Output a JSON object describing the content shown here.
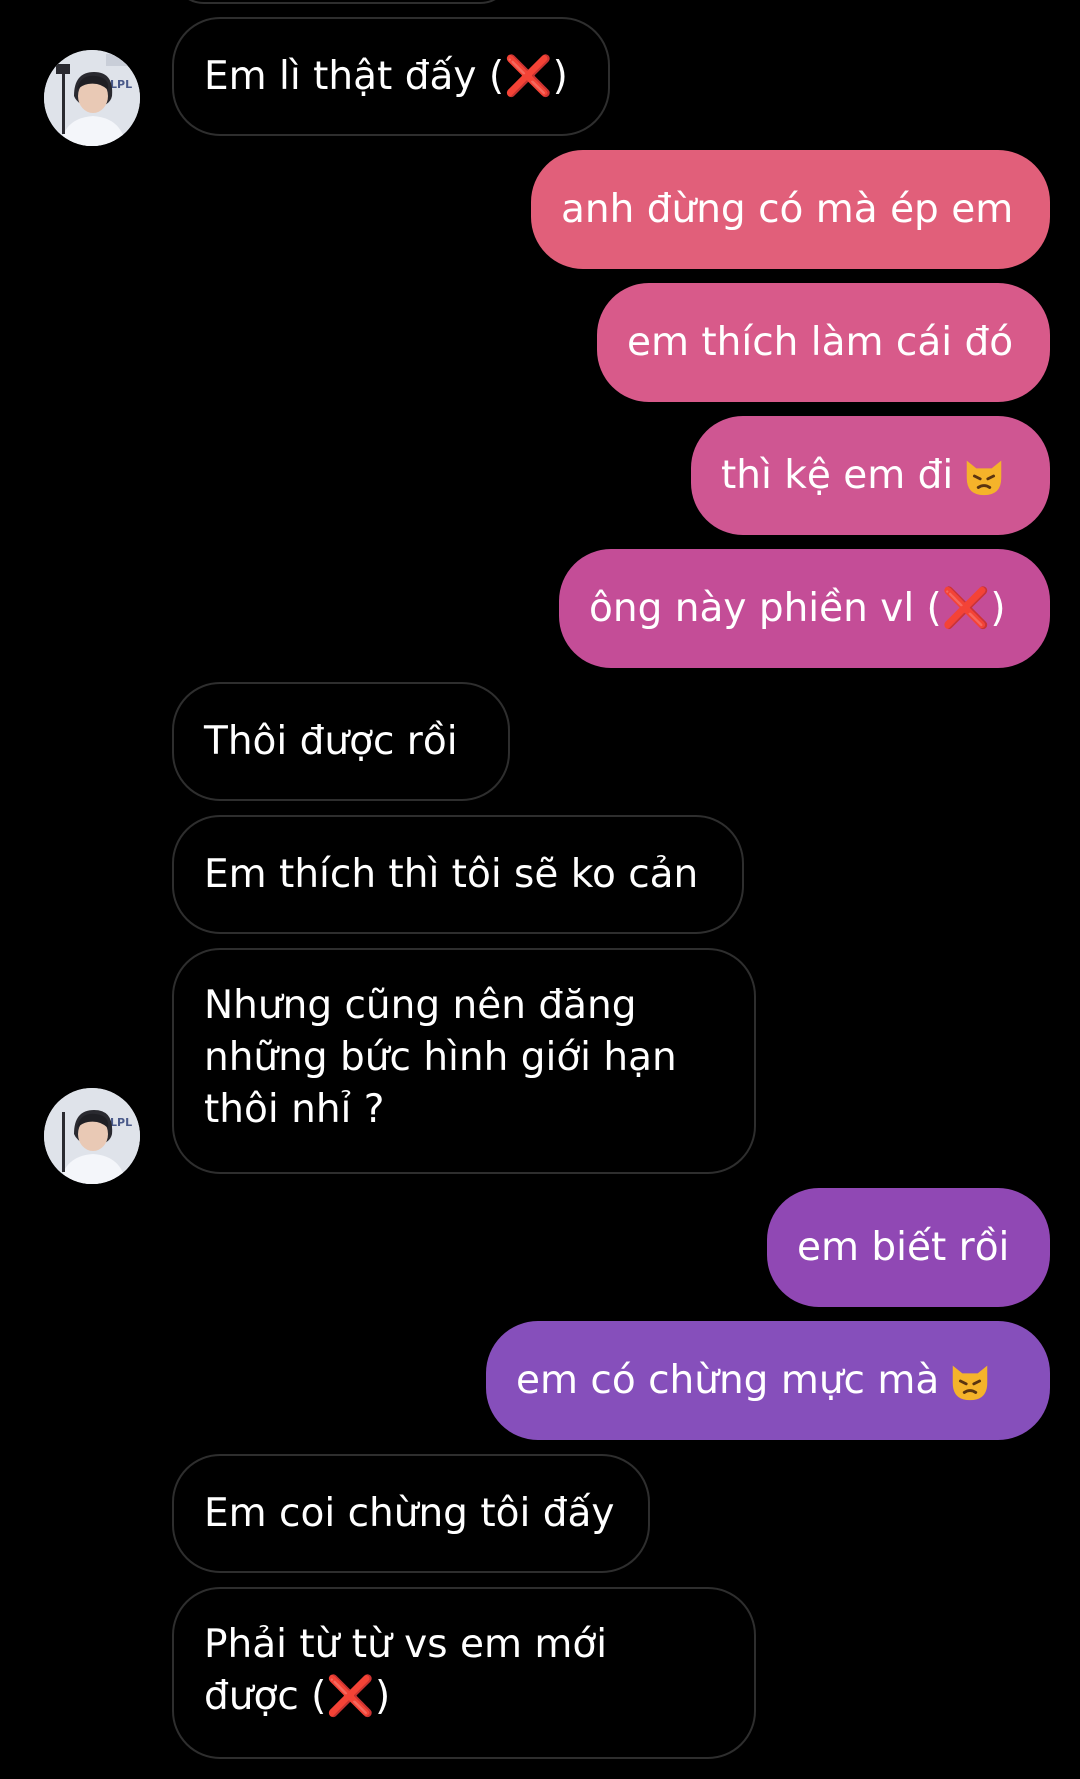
{
  "colors": {
    "background": "#000000",
    "incoming_border": "#2e2e2e",
    "outgoing_gradient_top": "#e35f78",
    "outgoing_gradient_bottom": "#8a4fba",
    "x_mark": "#e5202a"
  },
  "icons": {
    "x_mark": "cross-mark-icon",
    "cat": "pouting-cat-icon",
    "avatar": "contact-avatar"
  },
  "x_glyph": "❌",
  "messages": [
    {
      "from": "them",
      "text": "Em lì thật đấy (",
      "suffix": ")"
    },
    {
      "from": "me",
      "text": "anh đừng có mà ép em"
    },
    {
      "from": "me",
      "text": "em thích làm cái đó"
    },
    {
      "from": "me",
      "text": "thì kệ em đi"
    },
    {
      "from": "me",
      "text": "ông này phiền vl (",
      "suffix": ")"
    },
    {
      "from": "them",
      "text": "Thôi được rồi"
    },
    {
      "from": "them",
      "text": "Em thích thì tôi sẽ ko cản"
    },
    {
      "from": "them",
      "lines": [
        "Nhưng cũng nên đăng",
        "những bức hình giới hạn",
        "thôi nhỉ ?"
      ]
    },
    {
      "from": "me",
      "text": "em biết rồi"
    },
    {
      "from": "me",
      "text": "em có chừng mực mà"
    },
    {
      "from": "them",
      "text": "Em coi chừng tôi đấy"
    },
    {
      "from": "them",
      "lines": [
        "Phải từ từ vs em mới",
        "được ("
      ],
      "suffix": ")"
    }
  ],
  "avatar_badge": "LPL"
}
